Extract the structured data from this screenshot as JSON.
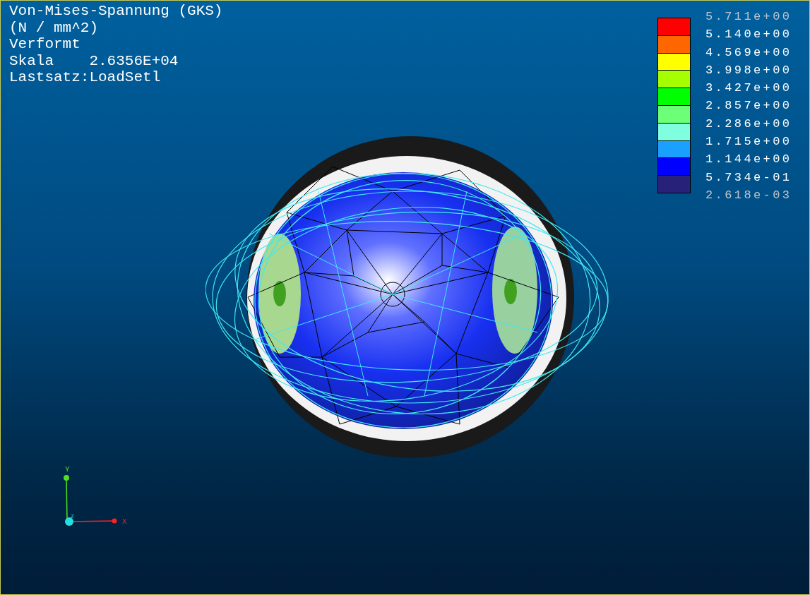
{
  "viewport": {
    "info_lines": [
      "Von-Mises-Spannung (GKS)",
      "(N / mm^2)",
      "Verformt",
      "Skala    2.6356E+04",
      "Lastsatz:LoadSetl"
    ],
    "legend": {
      "bands": [
        {
          "color": "#ff0000"
        },
        {
          "color": "#ff6600"
        },
        {
          "color": "#ffff00"
        },
        {
          "color": "#a6ff00"
        },
        {
          "color": "#00ff00"
        },
        {
          "color": "#6cff78"
        },
        {
          "color": "#80ffe0"
        },
        {
          "color": "#1aa0ff"
        },
        {
          "color": "#0000ff"
        },
        {
          "color": "#28217a"
        }
      ],
      "labels": [
        {
          "text": "5.711e+00",
          "dimmed": true
        },
        {
          "text": "5.140e+00",
          "dimmed": false
        },
        {
          "text": "4.569e+00",
          "dimmed": false
        },
        {
          "text": "3.998e+00",
          "dimmed": false
        },
        {
          "text": "3.427e+00",
          "dimmed": false
        },
        {
          "text": "2.857e+00",
          "dimmed": false
        },
        {
          "text": "2.286e+00",
          "dimmed": false
        },
        {
          "text": "1.715e+00",
          "dimmed": false
        },
        {
          "text": "1.144e+00",
          "dimmed": false
        },
        {
          "text": "5.734e-01",
          "dimmed": false
        },
        {
          "text": "2.618e-03",
          "dimmed": true
        }
      ]
    },
    "axes": {
      "x_label": "X",
      "y_label": "Y",
      "z_label": "Z"
    }
  }
}
